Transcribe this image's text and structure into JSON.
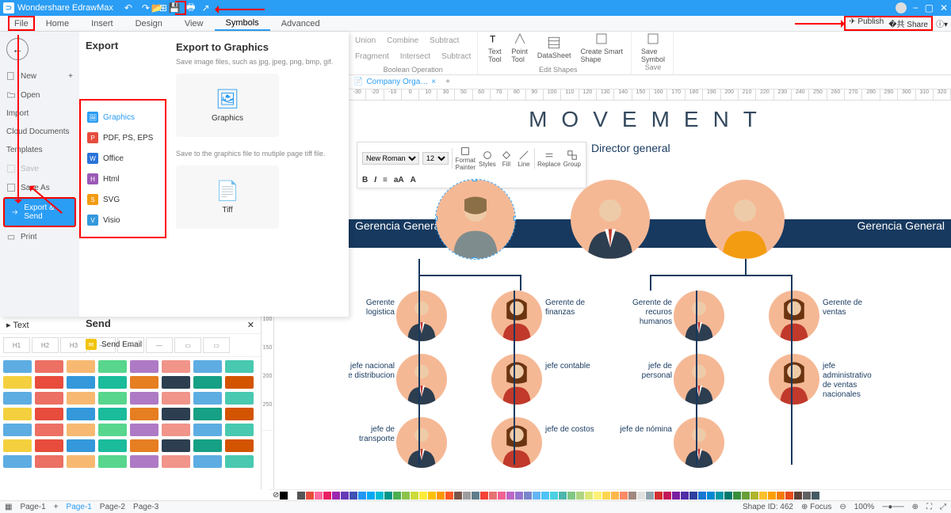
{
  "app": {
    "name": "Wondershare EdrawMax"
  },
  "qat": {
    "undo": "↶",
    "redo": "↷",
    "add": "⊞",
    "open": "📂",
    "save": "💾",
    "print": "🖶",
    "export": "↗"
  },
  "tabs": [
    "File",
    "Home",
    "Insert",
    "Design",
    "View",
    "Symbols",
    "Advanced"
  ],
  "topright": {
    "publish": "Publish",
    "share": "Share"
  },
  "ribbon": {
    "boolean": {
      "label": "Boolean Operation",
      "ops": [
        "Union",
        "Combine",
        "Subtract",
        "Fragment",
        "Intersect",
        "Subtract"
      ]
    },
    "editshapes": {
      "label": "Edit Shapes",
      "textTool": "Text\nTool",
      "pointTool": "Point\nTool",
      "datasheet": "DataSheet",
      "smart": "Create Smart\nShape"
    },
    "save": {
      "label": "Save",
      "saveSymbol": "Save\nSymbol"
    }
  },
  "file_nav": [
    "New",
    "Open",
    "Import",
    "Cloud Documents",
    "Templates",
    "Save",
    "Save As",
    "Export & Send",
    "Print"
  ],
  "file_sub": {
    "export": "Export",
    "items": [
      {
        "label": "Graphics",
        "color": "#2a9df5"
      },
      {
        "label": "PDF, PS, EPS",
        "color": "#e74c3c"
      },
      {
        "label": "Office",
        "color": "#2a9df5"
      },
      {
        "label": "Html",
        "color": "#9b59b6"
      },
      {
        "label": "SVG",
        "color": "#f39c12"
      },
      {
        "label": "Visio",
        "color": "#3498db"
      }
    ],
    "send": "Send",
    "sendItems": [
      {
        "label": "Send Email",
        "color": "#f1c40f"
      }
    ]
  },
  "export_panel": {
    "title": "Export to Graphics",
    "desc": "Save image files, such as jpg, jpeg, png, bmp, gif.",
    "card1": "Graphics",
    "tiffdesc": "Save to the graphics file to mutiple page tiff file.",
    "card2": "Tiff"
  },
  "doc_tab": "Company Orga…",
  "minitb": {
    "font": "New Roman",
    "size": "12",
    "tools": [
      "Format\nPainter",
      "Styles",
      "Fill",
      "Line",
      "Replace",
      "Group"
    ]
  },
  "org": {
    "title": "MOVEMENT",
    "director": "Director\ngeneral",
    "gerL": "Gerencia\nGeneral",
    "gerR": "Gerencia\nGeneral",
    "row2": [
      "Gerente\nlogistica",
      "Gerente\nde\nfinanzas",
      "Gerente de\nrecuros\nhumanos",
      "Gerente de\nventas"
    ],
    "row3": [
      "jefe nacional de\ndistribucion",
      "jefe\ncontable",
      "jefe de\npersonal",
      "jefe\nadministrativo\nde ventas\nnacionales"
    ],
    "row4": [
      "jefe de\ntransporte",
      "jefe de\ncostos",
      "jefe de\nnómina",
      ""
    ]
  },
  "library": {
    "title": "Text",
    "headings": [
      "H1",
      "H2",
      "H3",
      "—",
      "—",
      "—",
      "▭",
      "▭"
    ]
  },
  "ruler_marks": [
    "-30",
    "-20",
    "-10",
    "0",
    "10",
    "30",
    "50",
    "60",
    "70",
    "80",
    "90",
    "100",
    "110",
    "120",
    "130",
    "140",
    "150",
    "160",
    "170",
    "180",
    "190",
    "200",
    "210",
    "220",
    "230",
    "240",
    "250",
    "260",
    "270",
    "280",
    "290",
    "300",
    "310",
    "320"
  ],
  "vruler_marks": [
    "100",
    "150",
    "200",
    "250"
  ],
  "pages": [
    "Page-1",
    "Page-1",
    "Page-2",
    "Page-3"
  ],
  "status": {
    "shapeId": "Shape ID: 462",
    "focus": "Focus",
    "zoom": "100%"
  },
  "colors": [
    "#000",
    "#fff",
    "#555",
    "#e74c3c",
    "#ff6b9d",
    "#e91e63",
    "#9c27b0",
    "#673ab7",
    "#3f51b5",
    "#2196f3",
    "#03a9f4",
    "#00bcd4",
    "#009688",
    "#4caf50",
    "#8bc34a",
    "#cddc39",
    "#ffeb3b",
    "#ffc107",
    "#ff9800",
    "#ff5722",
    "#795548",
    "#9e9e9e",
    "#607d8b",
    "#f44336",
    "#e57373",
    "#f06292",
    "#ba68c8",
    "#9575cd",
    "#7986cb",
    "#64b5f6",
    "#4fc3f7",
    "#4dd0e1",
    "#4db6ac",
    "#81c784",
    "#aed581",
    "#dce775",
    "#fff176",
    "#ffd54f",
    "#ffb74d",
    "#ff8a65",
    "#a1887f",
    "#e0e0e0",
    "#90a4ae",
    "#d32f2f",
    "#c2185b",
    "#7b1fa2",
    "#512da8",
    "#303f9f",
    "#1976d2",
    "#0288d1",
    "#0097a7",
    "#00796b",
    "#388e3c",
    "#689f38",
    "#afb42b",
    "#fbc02d",
    "#ffa000",
    "#f57c00",
    "#e64a19",
    "#5d4037",
    "#616161",
    "#455a64"
  ]
}
